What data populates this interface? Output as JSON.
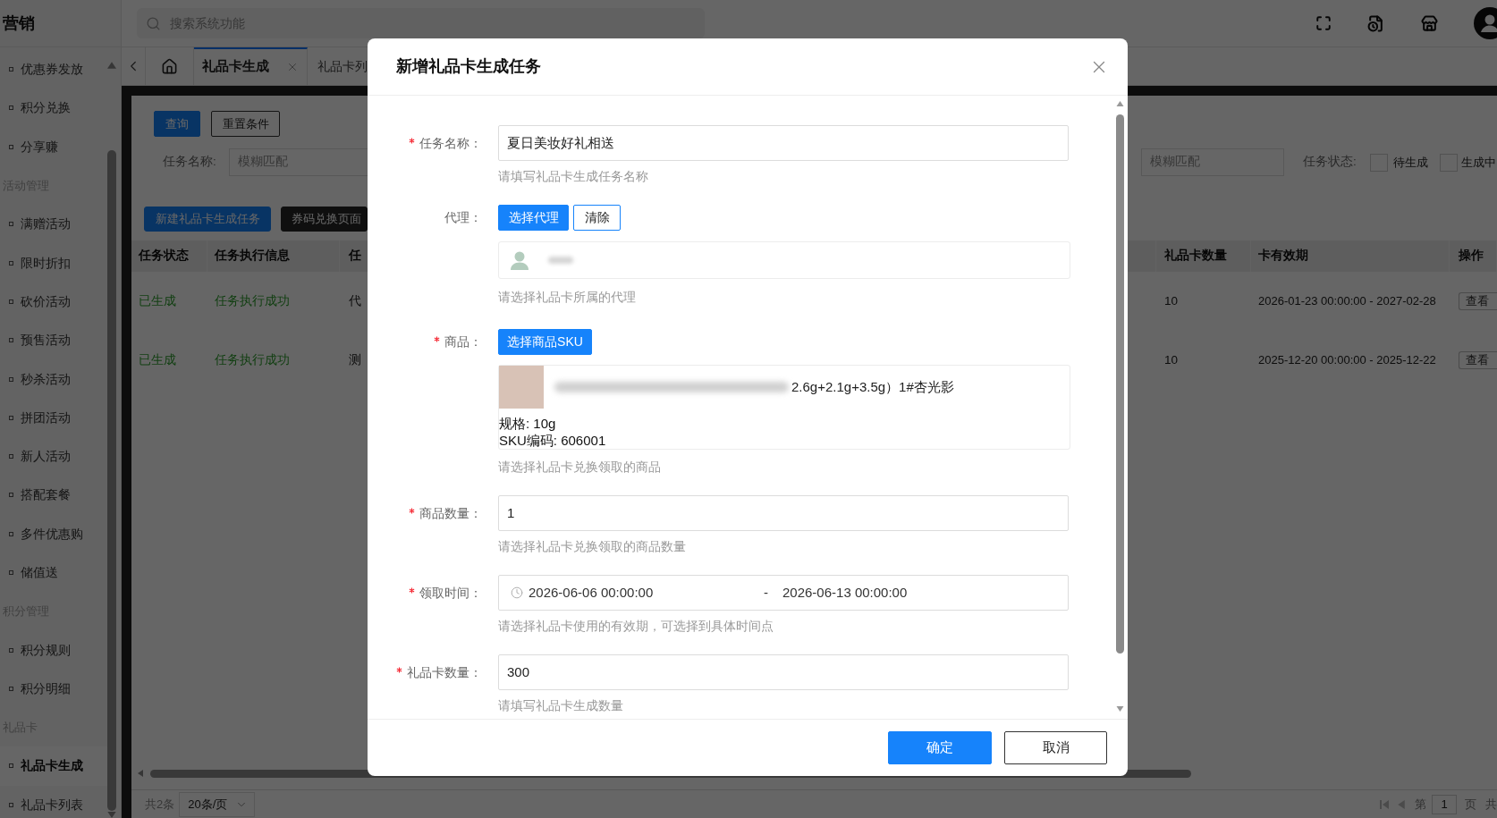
{
  "sidebar": {
    "title": "营销",
    "groups": [
      {
        "items": [
          {
            "label": "优惠券发放",
            "selected": false
          },
          {
            "label": "积分兑换",
            "selected": false
          },
          {
            "label": "分享赚",
            "selected": false
          }
        ]
      },
      {
        "heading": "活动管理",
        "items": [
          {
            "label": "满赠活动",
            "selected": false
          },
          {
            "label": "限时折扣",
            "selected": false
          },
          {
            "label": "砍价活动",
            "selected": false
          },
          {
            "label": "预售活动",
            "selected": false
          },
          {
            "label": "秒杀活动",
            "selected": false
          },
          {
            "label": "拼团活动",
            "selected": false
          },
          {
            "label": "新人活动",
            "selected": false
          },
          {
            "label": "搭配套餐",
            "selected": false
          },
          {
            "label": "多件优惠购",
            "selected": false
          },
          {
            "label": "储值送",
            "selected": false
          }
        ]
      },
      {
        "heading": "积分管理",
        "items": [
          {
            "label": "积分规则",
            "selected": false
          },
          {
            "label": "积分明细",
            "selected": false
          }
        ]
      },
      {
        "heading": "礼品卡",
        "items": [
          {
            "label": "礼品卡生成",
            "selected": true
          },
          {
            "label": "礼品卡列表",
            "selected": false
          }
        ]
      }
    ]
  },
  "top_bar": {
    "search": {
      "placeholder": "搜索系统功能"
    }
  },
  "tabs": [
    {
      "label": "礼品卡生成",
      "selected": true
    },
    {
      "label": "礼品卡列",
      "selected": false
    }
  ],
  "toolbar": [
    {
      "label": "查询",
      "kind": "primary"
    },
    {
      "label": "重置条件",
      "kind": "default"
    }
  ],
  "filters": {
    "task_name": {
      "label": "任务名称:",
      "placeholder": "模糊匹配"
    },
    "field_2": {
      "placeholder": "模糊匹配"
    },
    "task_status": {
      "label": "任务状态:",
      "options": [
        {
          "label": "待生成",
          "checked": false
        },
        {
          "label": "生成中",
          "checked": false
        }
      ]
    }
  },
  "actions": [
    {
      "label": "新建礼品卡生成任务",
      "kind": "primary"
    },
    {
      "label": "券码兑换页面",
      "kind": "dark"
    }
  ],
  "table": {
    "columns": [
      "任务状态",
      "任务执行信息",
      "任",
      "礼品卡数量",
      "卡有效期",
      "操作"
    ],
    "rows": [
      {
        "cells": [
          "已生成",
          "任务执行成功",
          "代",
          "10",
          "2026-01-23 00:00:00 - 2027-02-28"
        ],
        "action": "查看"
      },
      {
        "cells": [
          "已生成",
          "任务执行成功",
          "测",
          "10",
          "2025-12-20 00:00:00 - 2025-12-22"
        ],
        "action": "查看"
      }
    ]
  },
  "footer": {
    "total": "共2条",
    "page_size": "20条/页",
    "page_prefix": "第",
    "page": "1",
    "page_suffix": "页",
    "total_pages": "共"
  },
  "dialog": {
    "title": "新增礼品卡生成任务",
    "fields": [
      {
        "kind": "text",
        "label": "任务名称：",
        "required": true,
        "value": "夏日美妆好礼相送",
        "help": "请填写礼品卡生成任务名称"
      },
      {
        "kind": "agent",
        "label": "代理：",
        "required": false,
        "buttons": [
          {
            "label": "选择代理",
            "kind": "primary"
          },
          {
            "label": "清除",
            "kind": "outline"
          }
        ],
        "help": "请选择礼品卡所属的代理"
      },
      {
        "kind": "product",
        "label": "商品：",
        "required": true,
        "buttons": [
          {
            "label": "选择商品SKU",
            "kind": "primary"
          }
        ],
        "product": {
          "name": "2.6g+2.1g+3.5g）1#杏光影",
          "spec": "规格: 10g",
          "sku": "SKU编码: 606001"
        },
        "help": "请选择礼品卡兑换领取的商品"
      },
      {
        "kind": "text",
        "label": "商品数量：",
        "required": true,
        "value": "1",
        "help": "请选择礼品卡兑换领取的商品数量"
      },
      {
        "kind": "date_range",
        "label": "领取时间：",
        "required": true,
        "start": "2026-06-06 00:00:00",
        "separator": "-",
        "end": "2026-06-13 00:00:00",
        "help": "请选择礼品卡使用的有效期，可选择到具体时间点"
      },
      {
        "kind": "text",
        "label": "礼品卡数量：",
        "required": true,
        "value": "300",
        "help": "请填写礼品卡生成数量"
      }
    ],
    "buttons": [
      {
        "label": "确定",
        "kind": "primary"
      },
      {
        "label": "取消",
        "kind": "default"
      }
    ]
  }
}
